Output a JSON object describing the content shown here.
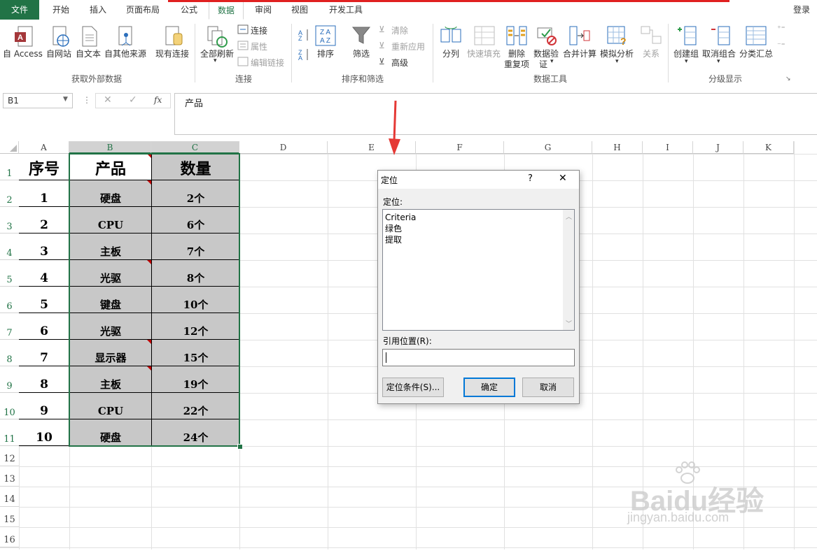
{
  "tabs": {
    "file": "文件",
    "home": "开始",
    "insert": "插入",
    "layout": "页面布局",
    "formulas": "公式",
    "data": "数据",
    "review": "审阅",
    "view": "视图",
    "developer": "开发工具"
  },
  "login": "登录",
  "ribbon": {
    "ext_data": {
      "access": "自 Access",
      "web": "自网站",
      "text": "自文本",
      "other": "自其他来源",
      "group": "获取外部数据"
    },
    "existing": "现有连接",
    "connections": {
      "refresh_all": "全部刷新",
      "connections": "连接",
      "properties": "属性",
      "edit_links": "编辑链接",
      "group": "连接"
    },
    "sort_filter": {
      "sort": "排序",
      "filter": "筛选",
      "clear": "清除",
      "reapply": "重新应用",
      "advanced": "高级",
      "group": "排序和筛选"
    },
    "tools": {
      "text_to_col": "分列",
      "flash_fill": "快速填充",
      "remove_dup_1": "删除",
      "remove_dup_2": "重复项",
      "validation_1": "数据验",
      "validation_2": "证",
      "consolidate": "合并计算",
      "whatif": "模拟分析",
      "relationships": "关系",
      "group": "数据工具"
    },
    "outline": {
      "group_btn": "创建组",
      "ungroup": "取消组合",
      "subtotal": "分类汇总",
      "group": "分级显示"
    }
  },
  "formula_bar": {
    "name_box": "B1",
    "fx": "fx",
    "content": "产品"
  },
  "columns": [
    "A",
    "B",
    "C",
    "D",
    "E",
    "F",
    "G",
    "H",
    "I",
    "J",
    "K"
  ],
  "rows": [
    "1",
    "2",
    "3",
    "4",
    "5",
    "6",
    "7",
    "8",
    "9",
    "10",
    "11",
    "12",
    "13",
    "14",
    "15",
    "16"
  ],
  "table": {
    "headers": [
      "序号",
      "产品",
      "数量"
    ],
    "data": [
      [
        "1",
        "硬盘",
        "2个"
      ],
      [
        "2",
        "CPU",
        "6个"
      ],
      [
        "3",
        "主板",
        "7个"
      ],
      [
        "4",
        "光驱",
        "8个"
      ],
      [
        "5",
        "键盘",
        "10个"
      ],
      [
        "6",
        "光驱",
        "12个"
      ],
      [
        "7",
        "显示器",
        "15个"
      ],
      [
        "8",
        "主板",
        "19个"
      ],
      [
        "9",
        "CPU",
        "22个"
      ],
      [
        "10",
        "硬盘",
        "24个"
      ]
    ]
  },
  "dialog": {
    "title": "定位",
    "help": "?",
    "close": "✕",
    "list_label": "定位:",
    "items": [
      "Criteria",
      "绿色",
      "提取"
    ],
    "ref_label": "引用位置(R):",
    "ref_value": "",
    "special_button": "定位条件(S)...",
    "ok_button": "确定",
    "cancel_button": "取消"
  },
  "watermark": "Baidu经验",
  "watermark_url": "jingyan.baidu.com",
  "colors": {
    "accent": "#217346",
    "selection_fill": "#c8c8c8",
    "arrow": "#e53935"
  }
}
